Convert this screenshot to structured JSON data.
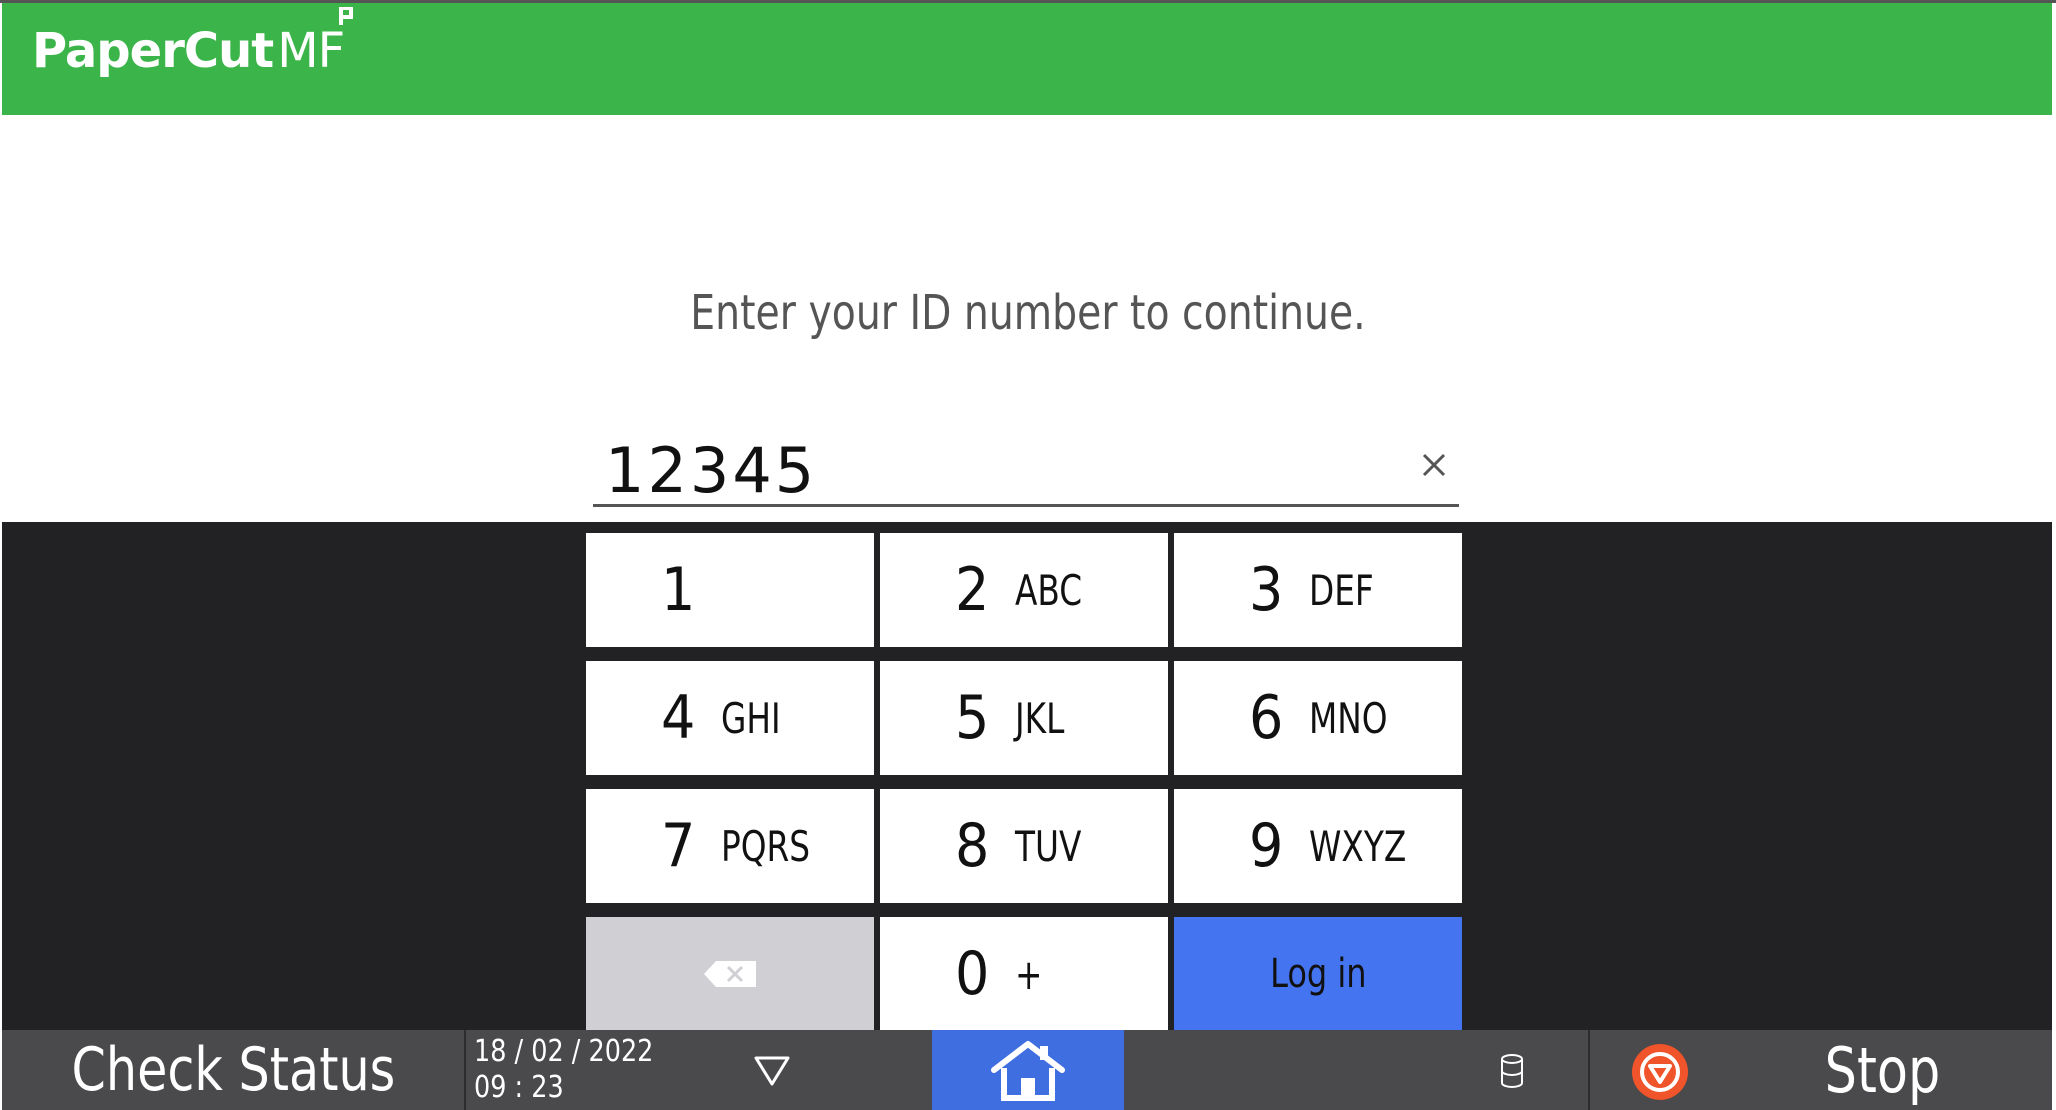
{
  "header": {
    "brand_left": "PaperCut",
    "brand_right": "MF",
    "color": "#3bb54a"
  },
  "prompt": "Enter your ID number to continue.",
  "id_input": {
    "value": "12345"
  },
  "keypad": {
    "keys": [
      {
        "digit": "1",
        "letters": ""
      },
      {
        "digit": "2",
        "letters": "ABC"
      },
      {
        "digit": "3",
        "letters": "DEF"
      },
      {
        "digit": "4",
        "letters": "GHI"
      },
      {
        "digit": "5",
        "letters": "JKL"
      },
      {
        "digit": "6",
        "letters": "MNO"
      },
      {
        "digit": "7",
        "letters": "PQRS"
      },
      {
        "digit": "8",
        "letters": "TUV"
      },
      {
        "digit": "9",
        "letters": "WXYZ"
      },
      {
        "digit": "0",
        "letters": "+"
      }
    ],
    "login_label": "Log in",
    "login_color": "#4474f0"
  },
  "bottom_bar": {
    "check_status": "Check Status",
    "date": "18 / 02 / 2022",
    "time": "09 : 23",
    "stop_label": "Stop",
    "stop_color": "#f0542a",
    "home_color": "#3f6ee0"
  }
}
